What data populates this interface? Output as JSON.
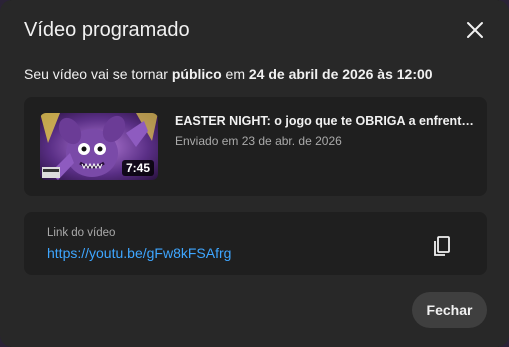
{
  "dialog": {
    "title": "Vídeo programado",
    "subtitle_prefix": "Seu vídeo vai se tornar ",
    "subtitle_visibility": "público",
    "subtitle_middle": " em ",
    "subtitle_datetime": "24 de abril de 2026 às 12:00",
    "close_icon": "close-icon"
  },
  "video": {
    "title": "EASTER NIGHT: o jogo que te OBRIGA a enfrentar...",
    "uploaded": "Enviado em 23 de abr. de 2026",
    "duration": "7:45"
  },
  "link": {
    "label": "Link do vídeo",
    "url": "https://youtu.be/gFw8kFSAfrg",
    "copy_icon": "copy-icon"
  },
  "footer": {
    "close_label": "Fechar"
  },
  "colors": {
    "background": "#282828",
    "card": "#1f1f1f",
    "link": "#3ea6ff",
    "button": "#3f3f3f"
  }
}
